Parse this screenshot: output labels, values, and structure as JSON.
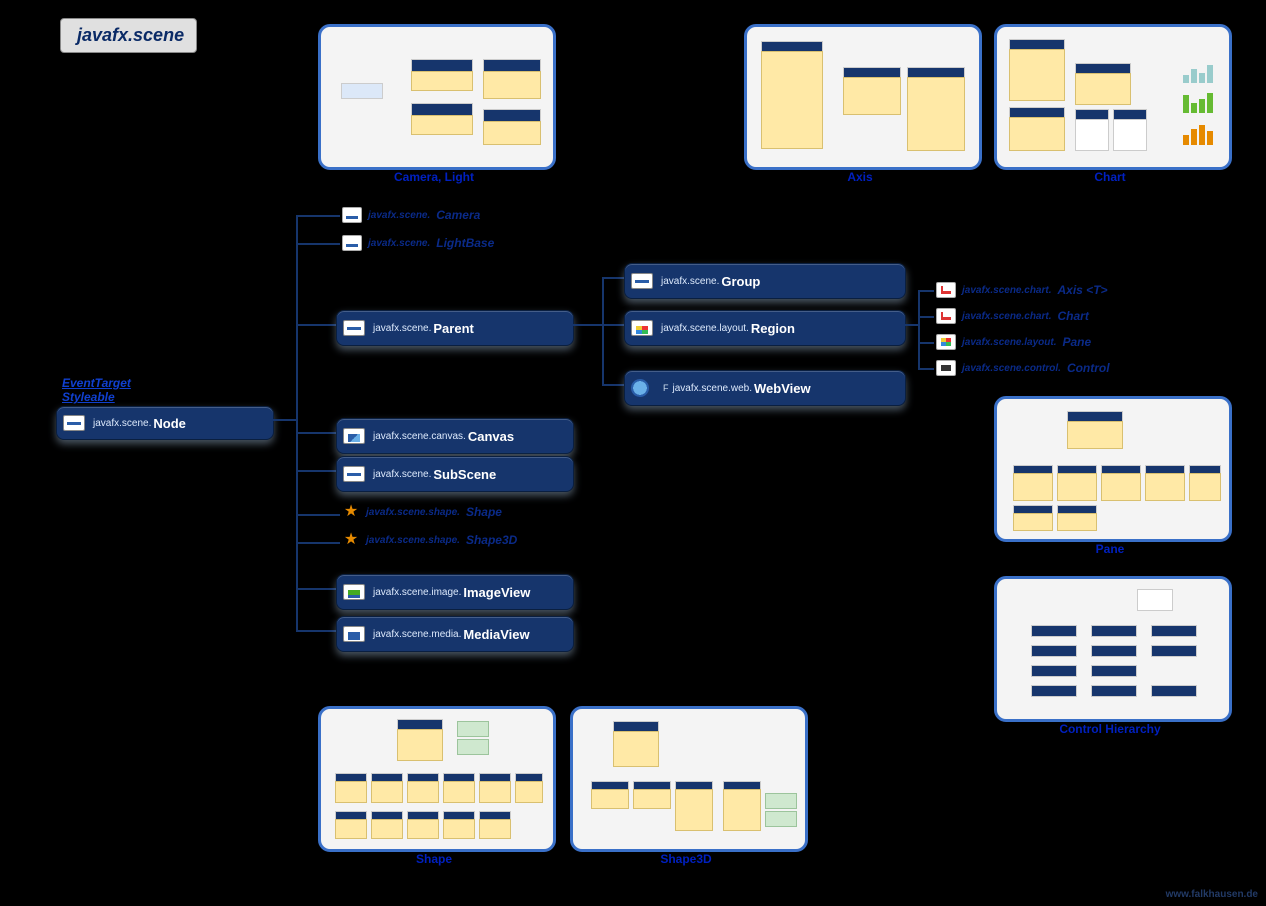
{
  "title": "javafx.scene",
  "interfaces": [
    "EventTarget",
    "Styleable"
  ],
  "node": {
    "pkg": "javafx.scene.",
    "cls": "Node"
  },
  "abstract_children": {
    "camera": {
      "pkg": "javafx.scene.",
      "cls": "Camera"
    },
    "lightbase": {
      "pkg": "javafx.scene.",
      "cls": "LightBase"
    },
    "shape": {
      "pkg": "javafx.scene.shape.",
      "cls": "Shape"
    },
    "shape3d": {
      "pkg": "javafx.scene.shape.",
      "cls": "Shape3D"
    }
  },
  "concrete_children": {
    "parent": {
      "pkg": "javafx.scene.",
      "cls": "Parent"
    },
    "canvas": {
      "pkg": "javafx.scene.canvas.",
      "cls": "Canvas"
    },
    "subscene": {
      "pkg": "javafx.scene.",
      "cls": "SubScene"
    },
    "imageview": {
      "pkg": "javafx.scene.image.",
      "cls": "ImageView"
    },
    "mediaview": {
      "pkg": "javafx.scene.media.",
      "cls": "MediaView"
    }
  },
  "parent_children": {
    "group": {
      "pkg": "javafx.scene.",
      "cls": "Group"
    },
    "region": {
      "pkg": "javafx.scene.layout.",
      "cls": "Region"
    },
    "webview": {
      "pkg": "javafx.scene.web.",
      "cls": "WebView"
    }
  },
  "region_children": {
    "axis": {
      "pkg": "javafx.scene.chart.",
      "cls": "Axis <T>"
    },
    "chart": {
      "pkg": "javafx.scene.chart.",
      "cls": "Chart"
    },
    "pane": {
      "pkg": "javafx.scene.layout.",
      "cls": "Pane"
    },
    "control": {
      "pkg": "javafx.scene.control.",
      "cls": "Control"
    }
  },
  "thumbs": {
    "camera_light": "Camera, Light",
    "axis": "Axis",
    "chart": "Chart",
    "pane": "Pane",
    "control_hier": "Control Hierarchy",
    "shape": "Shape",
    "shape3d": "Shape3D"
  },
  "footer": "www.falkhausen.de"
}
